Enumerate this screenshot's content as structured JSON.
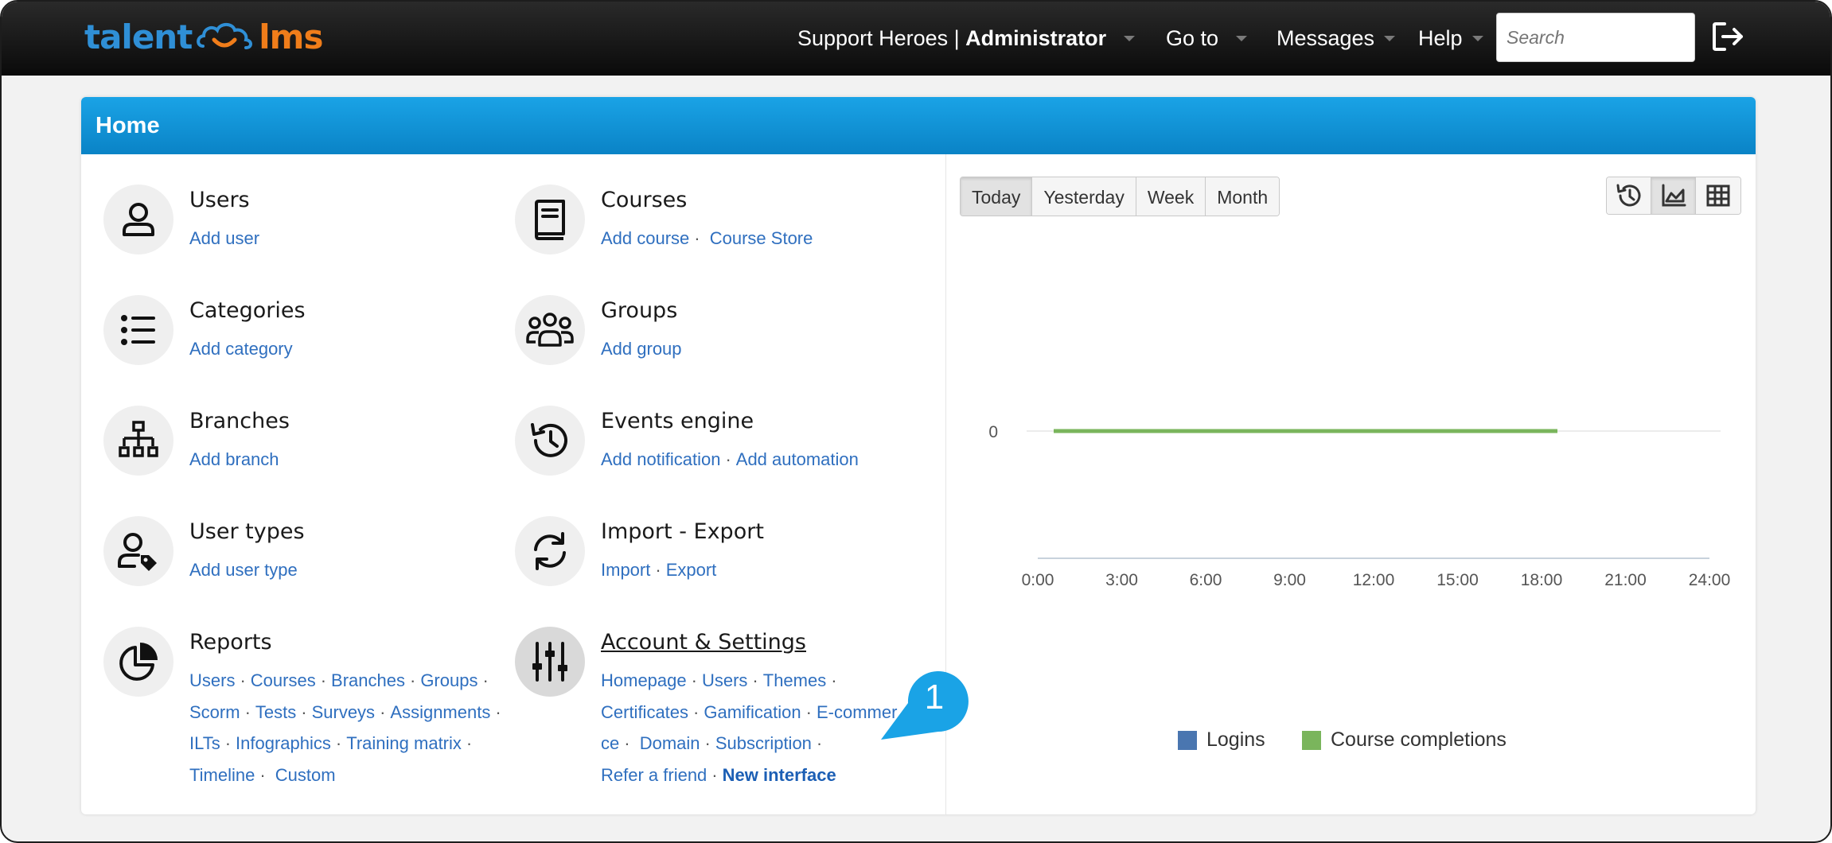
{
  "topbar": {
    "logo": {
      "talent": "talent",
      "lms": "lms"
    },
    "account": {
      "org": "Support Heroes | ",
      "role": "Administrator"
    },
    "nav": {
      "goto": "Go to",
      "messages": "Messages",
      "help": "Help"
    },
    "search_placeholder": "Search"
  },
  "page": {
    "title": "Home"
  },
  "items": {
    "users": {
      "title": "Users",
      "links": [
        "Add user"
      ]
    },
    "categories": {
      "title": "Categories",
      "links": [
        "Add category"
      ]
    },
    "branches": {
      "title": "Branches",
      "links": [
        "Add branch"
      ]
    },
    "usertypes": {
      "title": "User types",
      "links": [
        "Add user type"
      ]
    },
    "reports": {
      "title": "Reports",
      "links": [
        "Users",
        "Courses",
        "Branches",
        "Groups",
        "Scorm",
        "Tests",
        "Surveys",
        "Assignments",
        "ILTs",
        "Infographics",
        "Training matrix",
        "Timeline",
        "Custom"
      ]
    },
    "courses": {
      "title": "Courses",
      "links": [
        "Add course",
        "Course Store"
      ]
    },
    "groups": {
      "title": "Groups",
      "links": [
        "Add group"
      ]
    },
    "events": {
      "title": "Events engine",
      "links": [
        "Add notification",
        "Add automation"
      ]
    },
    "importexport": {
      "title": "Import - Export",
      "links": [
        "Import",
        "Export"
      ]
    },
    "account": {
      "title": "Account & Settings",
      "links": [
        "Homepage",
        "Users",
        "Themes",
        "Certificates",
        "Gamification",
        "E-commerce",
        "Domain",
        "Subscription",
        "Refer a friend",
        "New interface"
      ]
    }
  },
  "callout": {
    "number": "1",
    "color": "#1aa3e6"
  },
  "chart": {
    "tabs": [
      "Today",
      "Yesterday",
      "Week",
      "Month"
    ],
    "active_tab": "Today",
    "views": [
      "history-icon",
      "area-chart-icon",
      "table-icon"
    ],
    "active_view": "area-chart-icon"
  },
  "chart_data": {
    "type": "line",
    "x": [
      "0:00",
      "3:00",
      "6:00",
      "9:00",
      "12:00",
      "15:00",
      "18:00",
      "21:00",
      "24:00"
    ],
    "series": [
      {
        "name": "Logins",
        "color": "#4a76b0",
        "values": [
          0,
          0,
          0,
          0,
          0,
          0,
          0
        ]
      },
      {
        "name": "Course completions",
        "color": "#7ab55c",
        "values": [
          0,
          0,
          0,
          0,
          0,
          0,
          0
        ]
      }
    ],
    "y_ticks": [
      "0"
    ],
    "grid": true,
    "legend": "bottom"
  }
}
